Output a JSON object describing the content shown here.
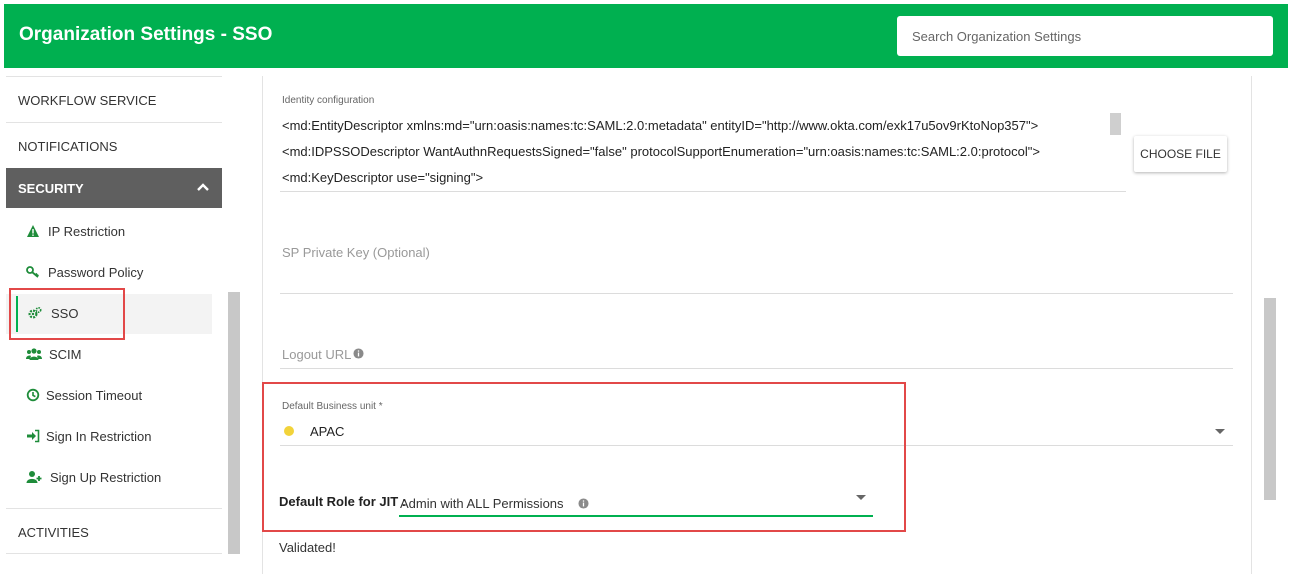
{
  "header": {
    "title": "Organization Settings - SSO",
    "search_placeholder": "Search Organization Settings"
  },
  "sidebar": {
    "sections": {
      "workflow": "WORKFLOW SERVICE",
      "notifications": "NOTIFICATIONS",
      "security": "SECURITY",
      "activities": "ACTIVITIES"
    },
    "security_items": [
      {
        "label": "IP Restriction",
        "icon": "warning-icon"
      },
      {
        "label": "Password Policy",
        "icon": "key-icon"
      },
      {
        "label": "SSO",
        "icon": "gears-icon"
      },
      {
        "label": "SCIM",
        "icon": "users-icon"
      },
      {
        "label": "Session Timeout",
        "icon": "clock-icon"
      },
      {
        "label": "Sign In Restriction",
        "icon": "sign-in-icon"
      },
      {
        "label": "Sign Up Restriction",
        "icon": "user-plus-icon"
      }
    ]
  },
  "form": {
    "identity_label": "Identity configuration",
    "identity_lines": [
      "<md:EntityDescriptor xmlns:md=\"urn:oasis:names:tc:SAML:2.0:metadata\" entityID=\"http://www.okta.com/exk17u5ov9rKtoNop357\">",
      "<md:IDPSSODescriptor WantAuthnRequestsSigned=\"false\" protocolSupportEnumeration=\"urn:oasis:names:tc:SAML:2.0:protocol\">",
      "<md:KeyDescriptor use=\"signing\">"
    ],
    "choose_file": "CHOOSE FILE",
    "sp_private_key": "SP Private Key (Optional)",
    "logout_url": "Logout URL",
    "business_unit_label": "Default Business unit *",
    "business_unit_value": "APAC",
    "jit_label": "Default Role for JIT :",
    "jit_value": "Admin with ALL Permissions",
    "validated": "Validated!"
  },
  "colors": {
    "brand": "#00b050",
    "highlight": "#e24848",
    "unit_dot": "#f2d33a"
  }
}
